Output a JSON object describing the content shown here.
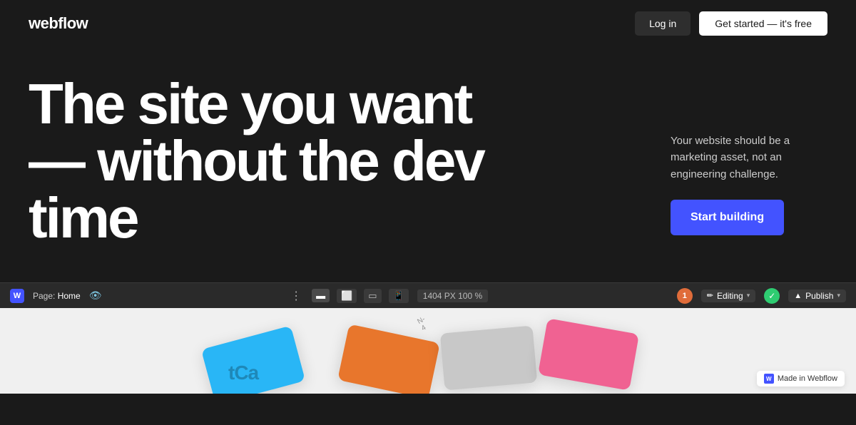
{
  "header": {
    "logo": "webflow",
    "login_label": "Log in",
    "get_started_label": "Get started — it's free"
  },
  "hero": {
    "headline": "The site you want — without the dev time",
    "subtext": "Your website should be a marketing asset, not an engineering challenge.",
    "cta_label": "Start building"
  },
  "editor_bar": {
    "logo": "W",
    "page_prefix": "Page:",
    "page_name": "Home",
    "dots": "⋮",
    "dimensions": "1404 PX  100 %",
    "avatar_label": "1",
    "editing_label": "Editing",
    "editing_chevron": "▾",
    "publish_label": "Publish",
    "publish_chevron": "▾"
  },
  "canvas": {
    "card_label": "N-4",
    "card_text": "tCa"
  },
  "made_in_webflow": {
    "logo": "W",
    "label": "Made in Webflow"
  },
  "icons": {
    "eye": "👁",
    "pencil": "✏",
    "check": "✓",
    "person": "▲"
  }
}
